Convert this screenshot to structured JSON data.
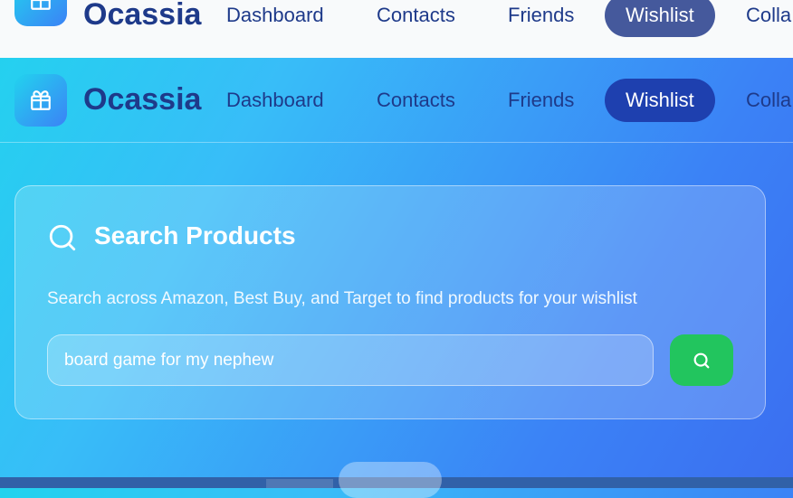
{
  "brand": {
    "name": "Ocassia",
    "logo_icon": "gift-icon"
  },
  "nav": {
    "items": [
      {
        "label": "Dashboard"
      },
      {
        "label": "Contacts"
      },
      {
        "label": "Friends"
      },
      {
        "label": "Wishlist",
        "active": true
      },
      {
        "label": "Colla"
      }
    ]
  },
  "search": {
    "title": "Search Products",
    "description": "Search across Amazon, Best Buy, and Target to find products for your wishlist",
    "value": "board game for my nephew",
    "button_icon": "search-icon"
  },
  "colors": {
    "accent": "#1e40af",
    "brand_text": "#1e3a8a",
    "search_button": "#22c55e"
  }
}
